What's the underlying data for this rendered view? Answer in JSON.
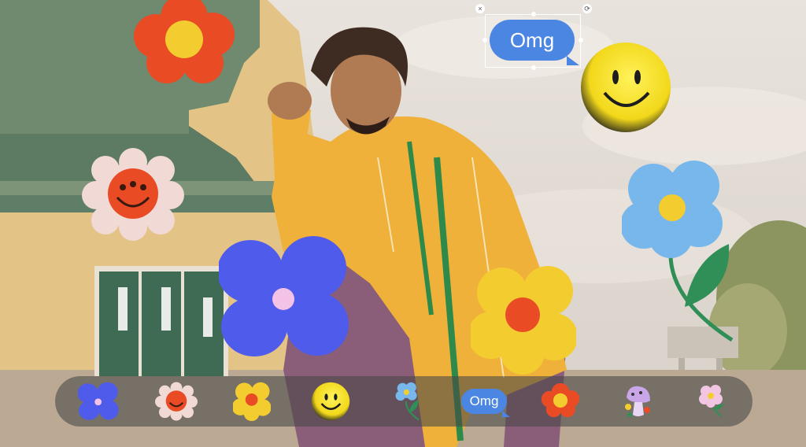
{
  "canvas": {
    "omg_sticker_text": "Omg",
    "selection_close_glyph": "×",
    "selection_rotate_glyph": "⟳"
  },
  "sticker_tray": {
    "items": [
      {
        "icon": "blue-flower-icon"
      },
      {
        "icon": "smiling-daisy-icon"
      },
      {
        "icon": "yellow-flower-icon"
      },
      {
        "icon": "smiley-face-icon"
      },
      {
        "icon": "blue-flower-stem-icon"
      },
      {
        "icon": "omg-bubble-icon",
        "label": "Omg"
      },
      {
        "icon": "red-flower-icon"
      },
      {
        "icon": "purple-mushroom-icon"
      },
      {
        "icon": "pink-flower-stem-icon"
      }
    ]
  },
  "colors": {
    "bubble_blue": "#4c86e3",
    "flower_red": "#e94b25",
    "flower_yellow": "#f3cc2f",
    "flower_blue": "#4f5bea",
    "sky_blue_flower": "#77b7ec",
    "stem_green": "#2f8f56",
    "tray_bg": "rgba(70,70,70,0.58)"
  }
}
